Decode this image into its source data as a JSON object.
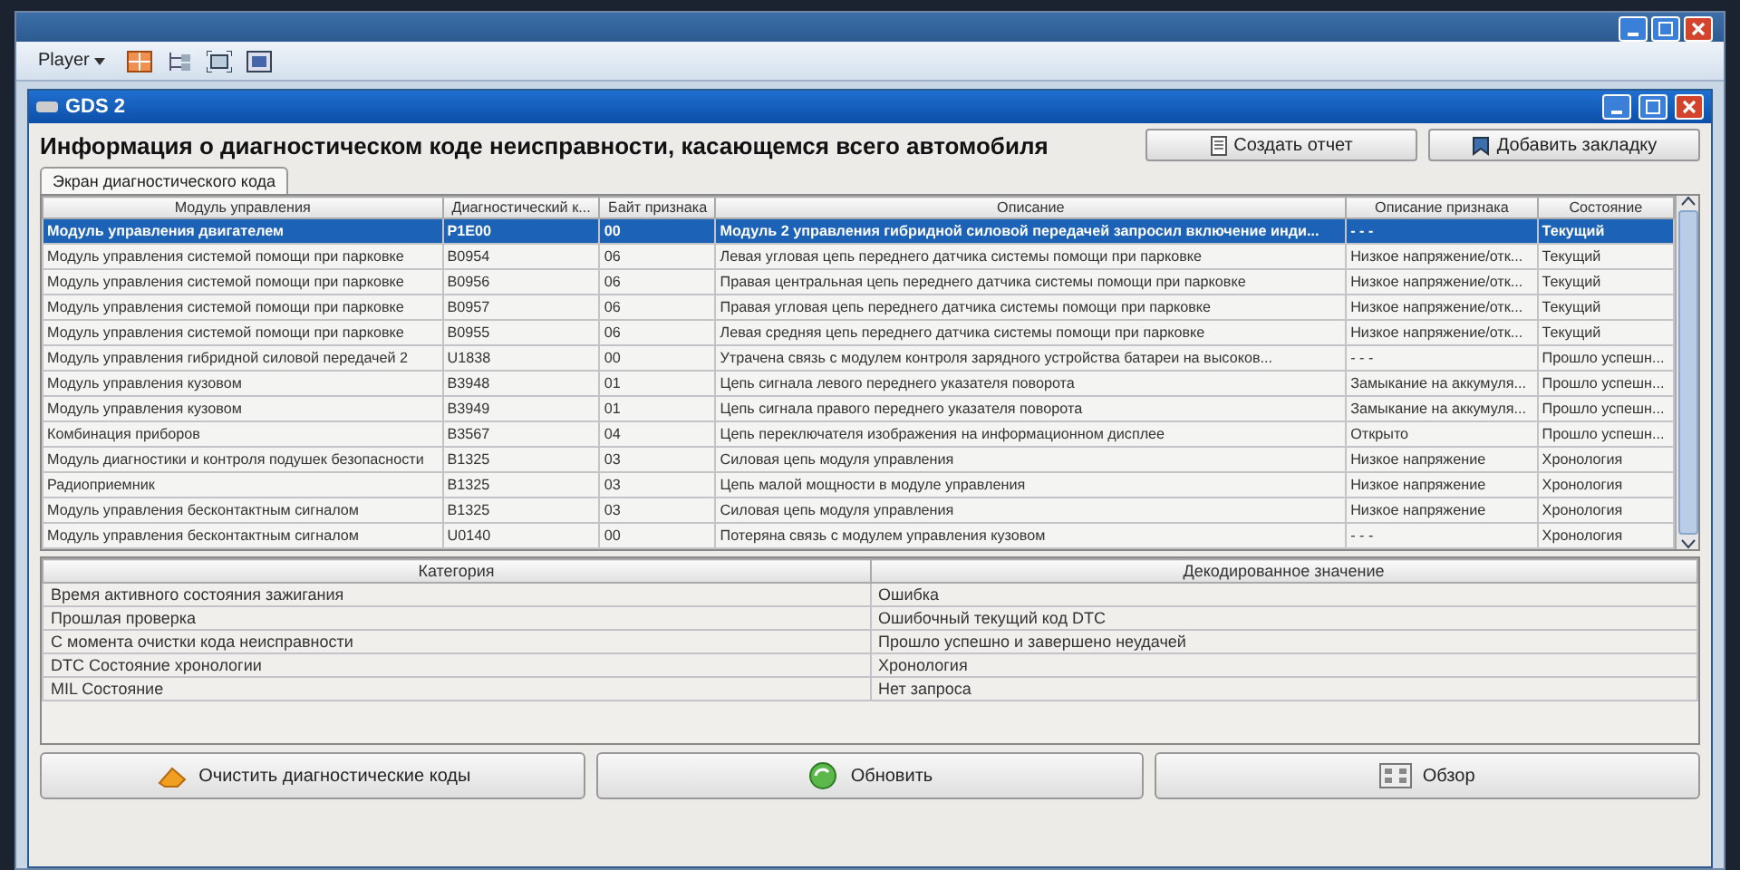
{
  "toolbar": {
    "player_menu": "Player"
  },
  "window": {
    "title": "GDS 2"
  },
  "header": {
    "title": "Информация о диагностическом коде неисправности, касающемся всего автомобиля",
    "buttons": [
      "Создать отчет",
      "Добавить закладку"
    ]
  },
  "tabs": [
    {
      "label": "Экран диагностического кода",
      "selected": true
    }
  ],
  "dtc_table": {
    "columns": [
      "Модуль управления",
      "Диагностический к...",
      "Байт признака",
      "Описание",
      "Описание признака",
      "Состояние"
    ],
    "rows": [
      {
        "cells": [
          "Модуль управления двигателем",
          "P1E00",
          "00",
          "Модуль 2 управления гибридной силовой передачей запросил включение инди...",
          "- - -",
          "Текущий"
        ],
        "selected": true
      },
      {
        "cells": [
          "Модуль управления системой помощи при парковке",
          "B0954",
          "06",
          "Левая угловая цепь переднего датчика системы помощи при парковке",
          "Низкое напряжение/отк...",
          "Текущий"
        ],
        "selected": false
      },
      {
        "cells": [
          "Модуль управления системой помощи при парковке",
          "B0956",
          "06",
          "Правая центральная цепь переднего датчика системы помощи при парковке",
          "Низкое напряжение/отк...",
          "Текущий"
        ],
        "selected": false
      },
      {
        "cells": [
          "Модуль управления системой помощи при парковке",
          "B0957",
          "06",
          "Правая угловая цепь переднего датчика системы помощи при парковке",
          "Низкое напряжение/отк...",
          "Текущий"
        ],
        "selected": false
      },
      {
        "cells": [
          "Модуль управления системой помощи при парковке",
          "B0955",
          "06",
          "Левая средняя цепь переднего датчика системы помощи при парковке",
          "Низкое напряжение/отк...",
          "Текущий"
        ],
        "selected": false
      },
      {
        "cells": [
          "Модуль управления гибридной силовой передачей 2",
          "U1838",
          "00",
          "Утрачена связь с модулем контроля зарядного устройства батареи на высоков...",
          "- - -",
          "Прошло успешн..."
        ],
        "selected": false
      },
      {
        "cells": [
          "Модуль управления кузовом",
          "B3948",
          "01",
          "Цепь сигнала левого переднего указателя поворота",
          "Замыкание на аккумуля...",
          "Прошло успешн..."
        ],
        "selected": false
      },
      {
        "cells": [
          "Модуль управления кузовом",
          "B3949",
          "01",
          "Цепь сигнала правого переднего указателя поворота",
          "Замыкание на аккумуля...",
          "Прошло успешн..."
        ],
        "selected": false
      },
      {
        "cells": [
          "Комбинация приборов",
          "B3567",
          "04",
          "Цепь переключателя изображения на информационном дисплее",
          "Открыто",
          "Прошло успешн..."
        ],
        "selected": false
      },
      {
        "cells": [
          "Модуль диагностики и контроля подушек безопасности",
          "B1325",
          "03",
          "Силовая цепь модуля управления",
          "Низкое напряжение",
          "Хронология"
        ],
        "selected": false
      },
      {
        "cells": [
          "Радиоприемник",
          "B1325",
          "03",
          "Цепь малой мощности в модуле управления",
          "Низкое напряжение",
          "Хронология"
        ],
        "selected": false
      },
      {
        "cells": [
          "Модуль управления бесконтактным сигналом",
          "B1325",
          "03",
          "Силовая цепь модуля управления",
          "Низкое напряжение",
          "Хронология"
        ],
        "selected": false
      },
      {
        "cells": [
          "Модуль управления бесконтактным сигналом",
          "U0140",
          "00",
          "Потеряна связь с модулем управления кузовом",
          "- - -",
          "Хронология"
        ],
        "selected": false
      }
    ]
  },
  "status_table": {
    "columns": [
      "Категория",
      "Декодированное значение"
    ],
    "rows": [
      [
        "Время активного состояния зажигания",
        "Ошибка"
      ],
      [
        "Прошлая проверка",
        "Ошибочный текущий код DTC"
      ],
      [
        "С момента очистки кода неисправности",
        "Прошло успешно и завершено неудачей"
      ],
      [
        "DTC Состояние хронологии",
        "Хронология"
      ],
      [
        "MIL Состояние",
        "Нет запроса"
      ]
    ]
  },
  "bottom_buttons": [
    {
      "kind": "clear",
      "label": "Очистить диагностические коды"
    },
    {
      "kind": "refresh",
      "label": "Обновить"
    },
    {
      "kind": "overview",
      "label": "Обзор"
    }
  ]
}
